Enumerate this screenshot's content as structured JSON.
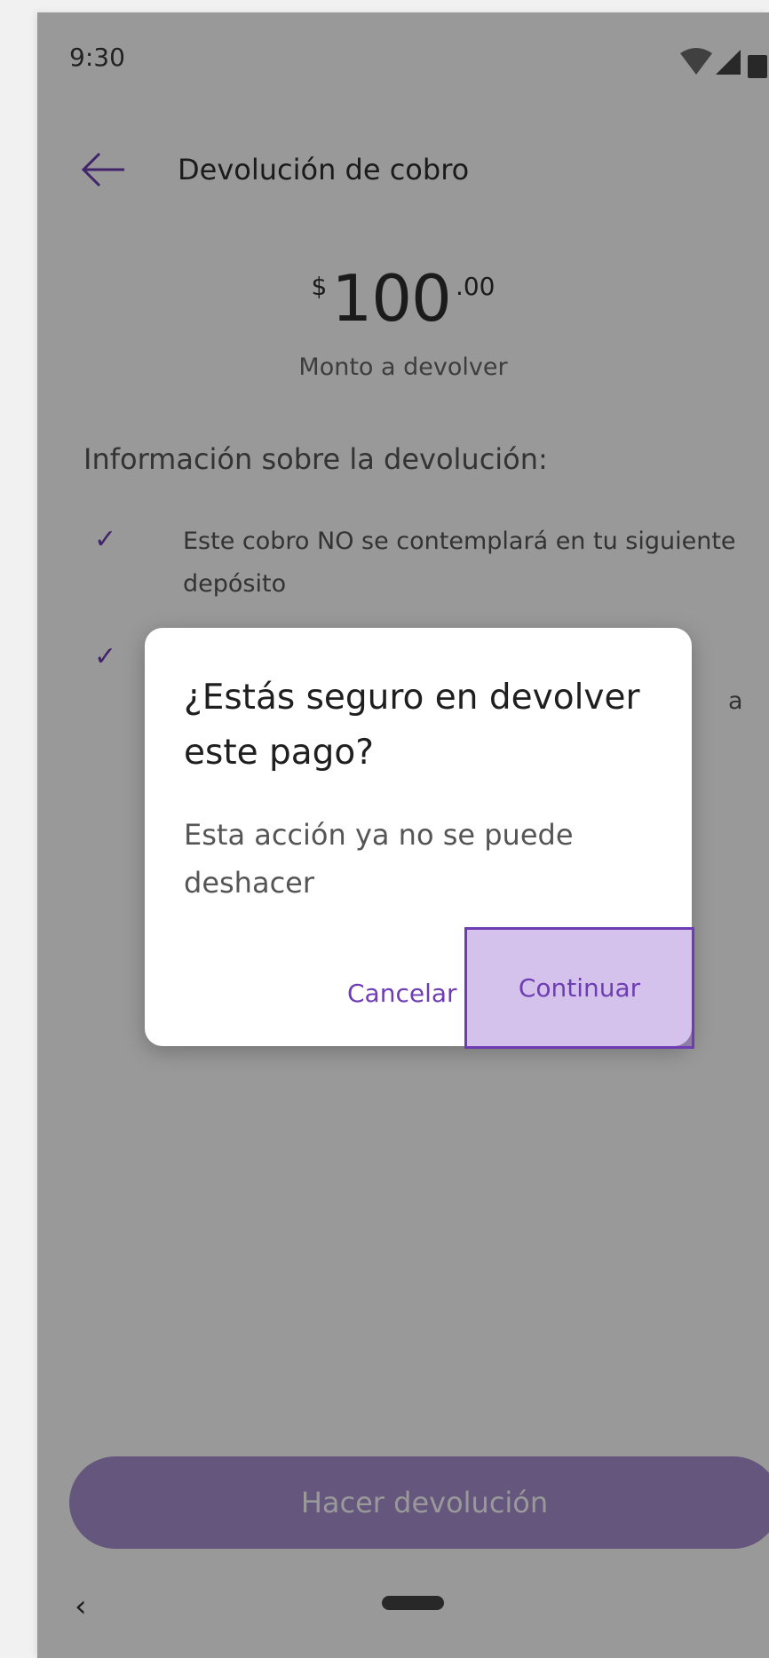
{
  "status_bar": {
    "time": "9:30"
  },
  "appbar": {
    "title": "Devolución de cobro"
  },
  "amount": {
    "currency": "$",
    "integer": "100",
    "decimals": ".00",
    "caption": "Monto a devolver"
  },
  "info": {
    "title": "Información sobre la devolución:",
    "items": [
      {
        "text_line1": "Este cobro NO se contemplará en tu siguiente",
        "text_line2": "depósito"
      },
      {
        "text_line1": "",
        "text_line2": "a"
      }
    ]
  },
  "primary_button": {
    "label": "Hacer devolución"
  },
  "dialog": {
    "title_line1": "¿Estás seguro en devolver",
    "title_line2": "este pago?",
    "body_line1": "Esta acción ya no se puede",
    "body_line2": "deshacer",
    "cancel_label": "Cancelar",
    "continue_label": "Continuar"
  },
  "colors": {
    "accent": "#6e3db4",
    "primary_button": "#a98fd0",
    "scrim": "rgba(0,0,0,0.40)"
  },
  "icons": {
    "back": "arrow-left-icon",
    "check": "check-icon",
    "wifi": "wifi-icon",
    "signal": "signal-icon",
    "battery": "battery-icon"
  }
}
